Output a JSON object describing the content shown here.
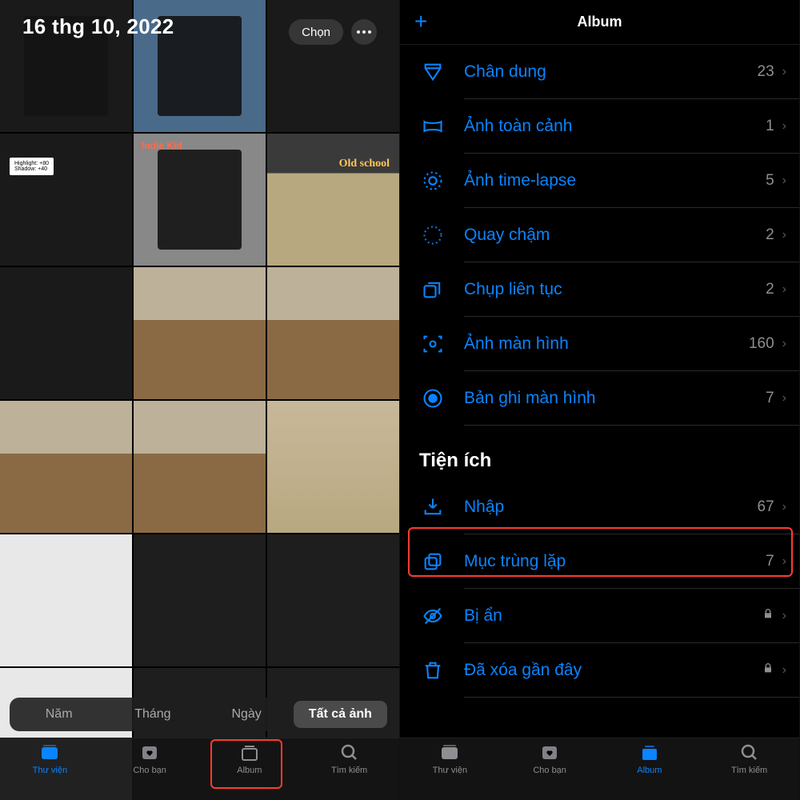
{
  "left": {
    "date": "16 thg 10, 2022",
    "select": "Chọn",
    "thumbs": {
      "highlight": "Highlight: +80",
      "shadow": "Shadow: +40",
      "indie": "Indie Kid",
      "oldschool": "Old school"
    },
    "segments": {
      "year": "Năm",
      "month": "Tháng",
      "day": "Ngày",
      "all": "Tất cả ảnh"
    }
  },
  "right": {
    "title": "Album",
    "sections": {
      "utilities": "Tiện ích"
    },
    "rows": {
      "portrait": {
        "label": "Chân dung",
        "count": "23"
      },
      "panorama": {
        "label": "Ảnh toàn cảnh",
        "count": "1"
      },
      "timelapse": {
        "label": "Ảnh time-lapse",
        "count": "5"
      },
      "slomo": {
        "label": "Quay chậm",
        "count": "2"
      },
      "burst": {
        "label": "Chụp liên tục",
        "count": "2"
      },
      "screenshot": {
        "label": "Ảnh màn hình",
        "count": "160"
      },
      "screenrec": {
        "label": "Bản ghi màn hình",
        "count": "7"
      },
      "import": {
        "label": "Nhập",
        "count": "67"
      },
      "duplicates": {
        "label": "Mục trùng lặp",
        "count": "7"
      },
      "hidden": {
        "label": "Bị ẩn"
      },
      "deleted": {
        "label": "Đã xóa gần đây"
      }
    }
  },
  "tabs": {
    "library": "Thư viện",
    "foryou": "Cho bạn",
    "album": "Album",
    "search": "Tìm kiếm"
  }
}
